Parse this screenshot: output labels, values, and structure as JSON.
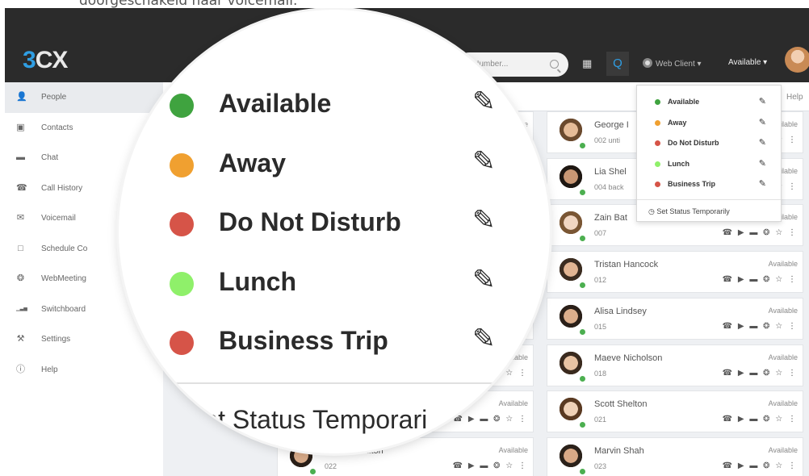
{
  "caption": "doorgeschakeld naar voicemail.",
  "header": {
    "logo": "3CX",
    "search_placeholder": "r Number...",
    "q_label": "Q",
    "web_client": "Web Client ▾",
    "status": "Available ▾"
  },
  "sidebar": {
    "items": [
      {
        "label": "People",
        "icon": "person-icon"
      },
      {
        "label": "Contacts",
        "icon": "contacts-icon"
      },
      {
        "label": "Chat",
        "icon": "chat-icon"
      },
      {
        "label": "Call History",
        "icon": "phone-icon"
      },
      {
        "label": "Voicemail",
        "icon": "voicemail-icon"
      },
      {
        "label": "Schedule Co",
        "icon": "calendar-icon"
      },
      {
        "label": "WebMeeting",
        "icon": "webmeeting-icon"
      },
      {
        "label": "Switchboard",
        "icon": "chart-icon"
      },
      {
        "label": "Settings",
        "icon": "wrench-icon"
      },
      {
        "label": "Help",
        "icon": "info-icon"
      }
    ]
  },
  "main": {
    "help": "Help"
  },
  "contacts_left": [
    {
      "status": "ailable"
    },
    {
      "status": "ile"
    },
    {
      "status": ""
    },
    {
      "status": "ile"
    },
    {
      "status": "able"
    },
    {
      "status": "Available"
    },
    {
      "status": "Available"
    },
    {
      "name": "Noah Hamilton",
      "ext": "022",
      "status": "Available"
    }
  ],
  "contacts_right": [
    {
      "name": "George I",
      "ext": "002 unti",
      "status": "ailable"
    },
    {
      "name": "Lia Shel",
      "ext": "004 back",
      "status": "ailable"
    },
    {
      "name": "Zain Bat",
      "ext": "007",
      "status": "ailable"
    },
    {
      "name": "Tristan Hancock",
      "ext": "012",
      "status": "Available"
    },
    {
      "name": "Alisa Lindsey",
      "ext": "015",
      "status": "Available"
    },
    {
      "name": "Maeve Nicholson",
      "ext": "018",
      "status": "Available"
    },
    {
      "name": "Scott Shelton",
      "ext": "021",
      "status": "Available"
    },
    {
      "name": "Marvin Shah",
      "ext": "023",
      "status": "Available"
    }
  ],
  "status_menu": {
    "items": [
      {
        "label": "Available",
        "color": "#3fa33f"
      },
      {
        "label": "Away",
        "color": "#f0a030"
      },
      {
        "label": "Do Not Disturb",
        "color": "#d65448"
      },
      {
        "label": "Lunch",
        "color": "#8ff06a"
      },
      {
        "label": "Business Trip",
        "color": "#d65448"
      }
    ],
    "temporary": "Set Status Temporarily"
  },
  "magnified": {
    "items": [
      {
        "label": "Available",
        "color": "#3fa33f"
      },
      {
        "label": "Away",
        "color": "#f0a030"
      },
      {
        "label": "Do Not Disturb",
        "color": "#d65448"
      },
      {
        "label": "Lunch",
        "color": "#8ff06a"
      },
      {
        "label": "Business Trip",
        "color": "#d65448"
      }
    ],
    "temporary": "Set Status Temporari"
  },
  "colors": {
    "topbar": "#2b2b2b",
    "brand": "#2f9ee3",
    "online": "#4caf50"
  }
}
